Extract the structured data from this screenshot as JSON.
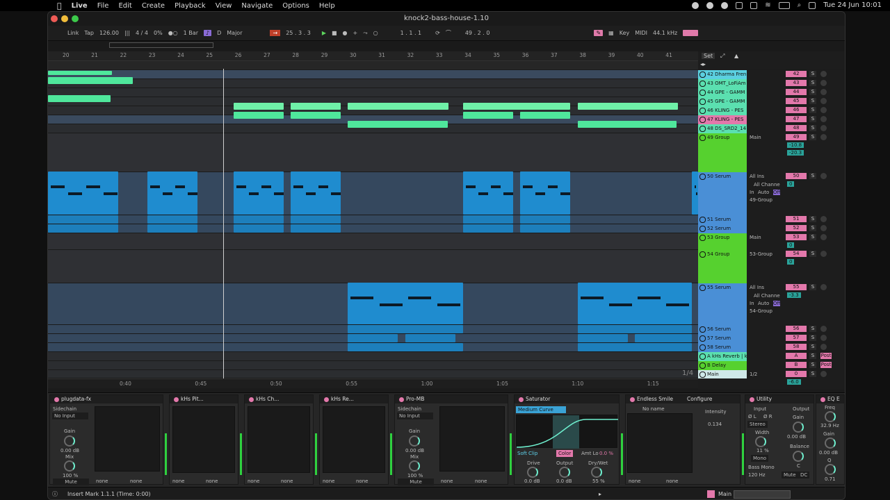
{
  "menubar": {
    "app": "Live",
    "items": [
      "File",
      "Edit",
      "Create",
      "Playback",
      "View",
      "Navigate",
      "Options",
      "Help"
    ],
    "clock": "Tue 24 Jun  10:01"
  },
  "window": {
    "title": "knock2-bass-house-1.10"
  },
  "transport": {
    "link": "Link",
    "tap": "Tap",
    "tempo": "126.00",
    "signature": "4 / 4",
    "swing": "0%",
    "quantize": "1 Bar",
    "key": "D",
    "scale": "Major",
    "position": "25 .  3 .  3",
    "loop_start": "1 .  1 .  1",
    "loop_length": "49 .  2 .  0",
    "key_label": "Key",
    "midi_label": "MIDI",
    "sample_rate": "44.1 kHz"
  },
  "ruler": [
    "20",
    "21",
    "22",
    "23",
    "24",
    "25",
    "26",
    "27",
    "28",
    "29",
    "30",
    "31",
    "32",
    "33",
    "34",
    "35",
    "36",
    "37",
    "38",
    "39",
    "40",
    "41"
  ],
  "set_label": "Set",
  "timebar": [
    "0:40",
    "0:45",
    "0:50",
    "0:55",
    "1:00",
    "1:05",
    "1:10",
    "1:15"
  ],
  "zoom_fraction": "1/4",
  "tracks": [
    {
      "name": "42 Dharma Fren",
      "num": "42"
    },
    {
      "name": "43 OMT_LoFiAm",
      "num": "43"
    },
    {
      "name": "44 GPE - GAMM",
      "num": "44"
    },
    {
      "name": "45 GPE - GAMM",
      "num": "45"
    },
    {
      "name": "46 KLING - PES",
      "num": "46"
    },
    {
      "name": "47 KLING - PES",
      "num": "47"
    },
    {
      "name": "48 DS_SRD2_14",
      "num": "48"
    },
    {
      "name": "49 Group",
      "num": "49",
      "route": "Main",
      "vol": "-10.8",
      "vol2": "-20.3"
    },
    {
      "name": "50 Serum",
      "num": "50",
      "route": "All Ins",
      "route2": "All Channe",
      "route3": "49-Group",
      "vol": "0"
    },
    {
      "name": "51 Serum",
      "num": "51"
    },
    {
      "name": "52 Serum",
      "num": "52"
    },
    {
      "name": "53 Group",
      "num": "53",
      "route": "Main",
      "vol": "0"
    },
    {
      "name": "54 Group",
      "num": "54",
      "route": "53-Group",
      "vol": "0"
    },
    {
      "name": "55 Serum",
      "num": "55",
      "route": "All Ins",
      "route2": "All Channe",
      "route3": "54-Group",
      "vol": "-3.3"
    },
    {
      "name": "56 Serum",
      "num": "56"
    },
    {
      "name": "57 Serum",
      "num": "57"
    },
    {
      "name": "58 Serum",
      "num": "58"
    },
    {
      "name": "A kHs Reverb | k",
      "num": "A",
      "post": "Post"
    },
    {
      "name": "B Delay",
      "num": "B",
      "post": "Post"
    },
    {
      "name": "Main",
      "num": "0",
      "route": "1/2",
      "vol": "-6.0"
    }
  ],
  "mixer_labels": {
    "in": "In",
    "auto": "Auto",
    "off": "Off",
    "minf": "-∞",
    "c": "C",
    "s": "S"
  },
  "devices": {
    "plugdata": {
      "name": "plugdata-fx",
      "sidechain": "Sidechain",
      "no_input": "No Input",
      "gain": "Gain",
      "gain_val": "0.00 dB",
      "mix": "Mix",
      "mix_val": "100 %",
      "mute": "Mute",
      "none1": "none",
      "none2": "none"
    },
    "pitch": {
      "name": "kHs Pit...",
      "none1": "none",
      "none2": "none"
    },
    "chorus": {
      "name": "kHs Ch...",
      "none1": "none",
      "none2": "none"
    },
    "reverb": {
      "name": "kHs Re...",
      "none1": "none",
      "none2": "none"
    },
    "promb": {
      "name": "Pro-MB",
      "sidechain": "Sidechain",
      "no_input": "No Input",
      "gain": "Gain",
      "gain_val": "0.00 dB",
      "mix": "Mix",
      "mix_val": "100 %",
      "mute": "Mute",
      "none1": "none",
      "none2": "none"
    },
    "saturator": {
      "name": "Saturator",
      "curve": "Medium Curve",
      "soft_clip": "Soft Clip",
      "color": "Color",
      "amt": "Amt Lo",
      "amt_val": "0.0 %",
      "drive": "Drive",
      "drive_val": "0.0 dB",
      "output": "Output",
      "output_val": "0.0 dB",
      "drywet": "Dry/Wet",
      "drywet_val": "55 %"
    },
    "smile": {
      "name": "Endless Smile",
      "configure": "Configure",
      "no_name": "No name",
      "intensity": "Intensity",
      "intensity_val": "0.134",
      "none1": "none",
      "none2": "none"
    },
    "utility": {
      "name": "Utility",
      "input": "Input",
      "output": "Output",
      "l": "Ø L",
      "r": "Ø R",
      "gain": "Gain",
      "gain_val": "0.00 dB",
      "stereo": "Stereo",
      "width": "Width",
      "width_val": "11 %",
      "mono": "Mono",
      "balance": "Balance",
      "balance_val": "C",
      "bass_mono": "Bass Mono",
      "bass_freq": "120 Hz",
      "mute": "Mute",
      "dc": "DC"
    },
    "eq": {
      "name": "EQ E",
      "freq": "Freq",
      "freq_val": "32.9 Hz",
      "gain": "Gain",
      "gain_val": "0.00 dB",
      "q": "Q",
      "q_val": "0.71"
    }
  },
  "status": {
    "text": "Insert Mark 1.1.1 (Time: 0:00)",
    "main": "Main"
  },
  "colors": {
    "clip_green": "#4fe79c",
    "clip_blue": "#1f8ccf",
    "group_green": "#56d12f",
    "track_pink": "#e378ab"
  }
}
